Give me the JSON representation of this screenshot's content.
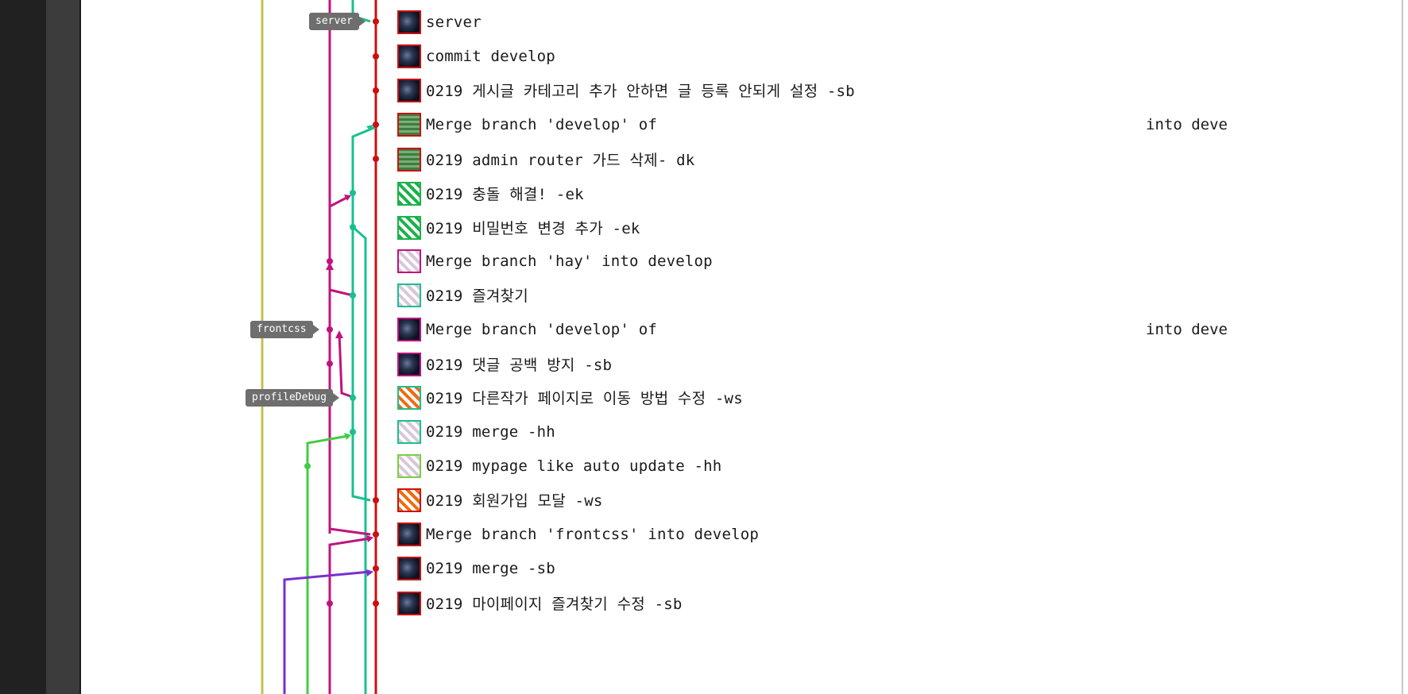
{
  "branch_tags": [
    "server",
    "frontcss",
    "profileDebug"
  ],
  "commits": [
    {
      "message": "server",
      "avatar": "dark-avatar"
    },
    {
      "message": "commit develop",
      "avatar": "dark-avatar"
    },
    {
      "message": "0219 게시글 카테고리 추가 안하면 글 등록 안되게 설정 -sb",
      "avatar": "dark-avatar"
    },
    {
      "message": "Merge branch 'develop' of",
      "tail": "into deve",
      "avatar": "green-pattern-avatar"
    },
    {
      "message": "0219 admin router 가드 삭제- dk",
      "avatar": "green-pattern-avatar"
    },
    {
      "message": "0219 충돌 해결! -ek",
      "avatar": "green-identicon-avatar"
    },
    {
      "message": "0219 비밀번호 변경 추가 -ek",
      "avatar": "green-identicon-avatar"
    },
    {
      "message": "Merge branch 'hay' into develop",
      "avatar": "pink-identicon-avatar"
    },
    {
      "message": "0219 즐겨찾기",
      "avatar": "teal-identicon-avatar"
    },
    {
      "message": "Merge branch 'develop' of",
      "tail": "into deve",
      "avatar": "dark-avatar"
    },
    {
      "message": "0219 댓글 공백 방지 -sb",
      "avatar": "dark-avatar"
    },
    {
      "message": "0219 다른작가 페이지로 이동 방법 수정 -ws",
      "avatar": "orange-identicon-avatar"
    },
    {
      "message": "0219 merge -hh",
      "avatar": "teal-identicon-avatar"
    },
    {
      "message": "0219 mypage like auto update -hh",
      "avatar": "lime-identicon-avatar"
    },
    {
      "message": "0219 회원가입 모달 -ws",
      "avatar": "orange-identicon-avatar"
    },
    {
      "message": "Merge branch 'frontcss' into develop",
      "avatar": "dark-avatar"
    },
    {
      "message": "0219 merge -sb",
      "avatar": "dark-avatar"
    },
    {
      "message": "0219 마이페이지 즐겨찾기 수정 -sb",
      "avatar": "dark-avatar"
    }
  ],
  "colors": {
    "main_line": "#cc1010",
    "pink_line": "#c0137e",
    "teal_line": "#18c090",
    "green_line": "#44cc44",
    "yellow_line": "#c8bf50",
    "purple_line": "#7a2ed0"
  }
}
